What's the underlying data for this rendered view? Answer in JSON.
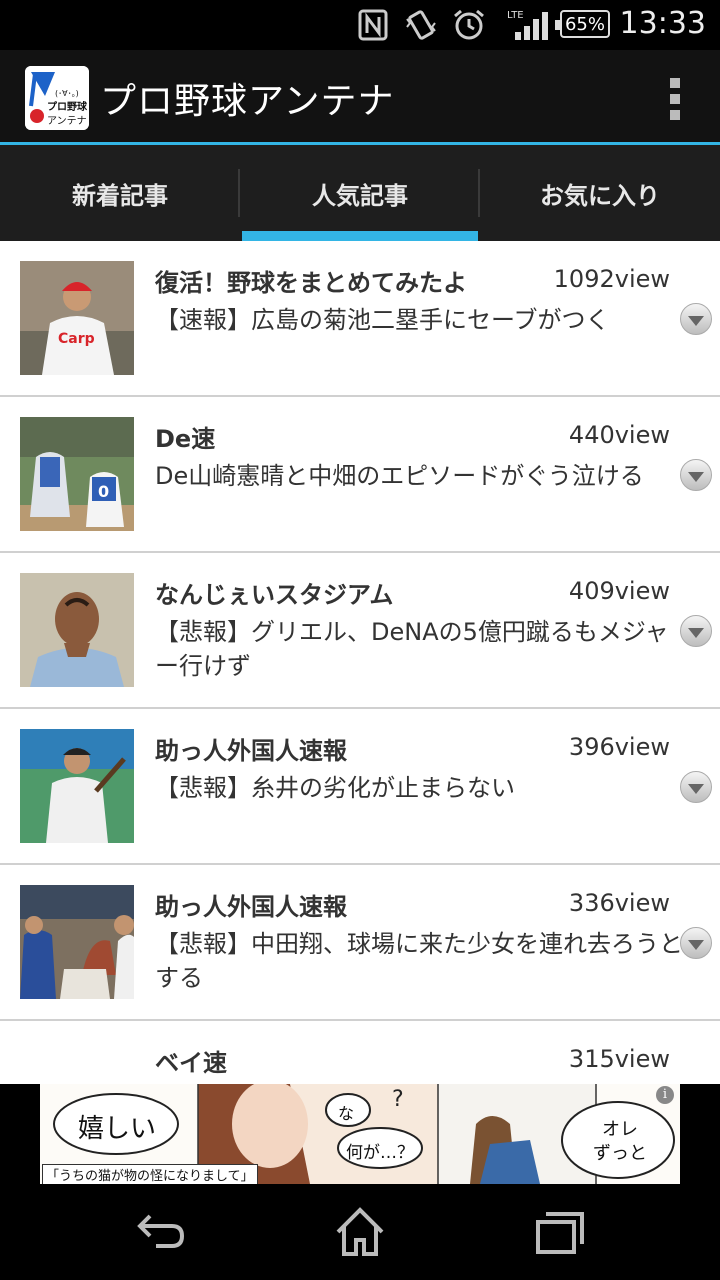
{
  "status_bar": {
    "time": "13:33",
    "battery": "65%",
    "network": "LTE",
    "icons": [
      "nfc-icon",
      "vibrate-icon",
      "alarm-icon",
      "signal-icon",
      "battery-icon"
    ]
  },
  "app": {
    "title": "プロ野球アンテナ",
    "icon_lines": [
      "(･∀･。)",
      "プロ野球",
      "アンテナ"
    ],
    "accent_color": "#33b5e5"
  },
  "tabs": [
    {
      "label": "新着記事",
      "active": false
    },
    {
      "label": "人気記事",
      "active": true
    },
    {
      "label": "お気に入り",
      "active": false
    }
  ],
  "articles": [
    {
      "site": "復活！野球をまとめてみたよ",
      "views": "1092view",
      "headline": "【速報】広島の菊池二塁手にセーブがつく"
    },
    {
      "site": "De速",
      "views": "440view",
      "headline": "De山崎憲晴と中畑のエピソードがぐう泣ける"
    },
    {
      "site": "なんじぇいスタジアム",
      "views": "409view",
      "headline": "【悲報】グリエル、DeNAの5億円蹴るもメジャー行けず"
    },
    {
      "site": "助っ人外国人速報",
      "views": "396view",
      "headline": "【悲報】糸井の劣化が止まらない"
    },
    {
      "site": "助っ人外国人速報",
      "views": "336view",
      "headline": "【悲報】中田翔、球場に来た少女を連れ去ろうとする"
    },
    {
      "site": "ベイ速",
      "views": "315view",
      "headline": ""
    }
  ],
  "ad": {
    "bubble1": "嬉しい",
    "caption": "「うちの猫が物の怪になりまして」",
    "bubble2": "な",
    "bubble3": "何が…？",
    "bubble4": "オレ\nずっと",
    "info": "i"
  }
}
